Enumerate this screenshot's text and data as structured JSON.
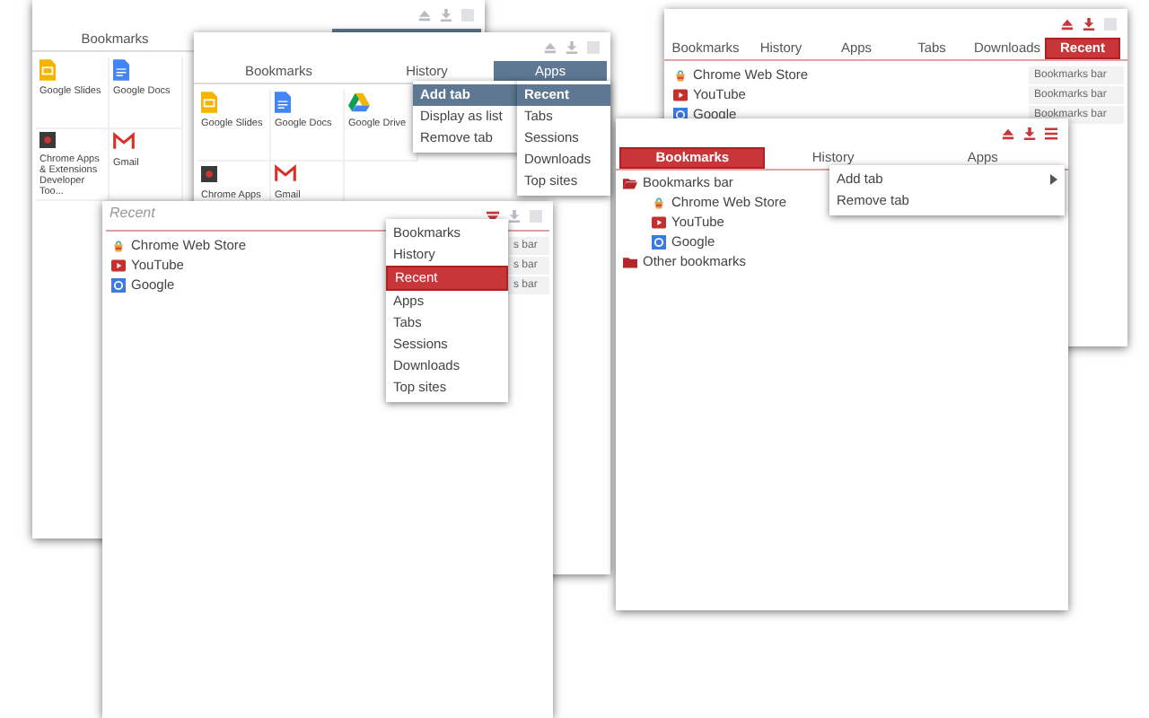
{
  "windows": [
    {
      "tabs": [
        {
          "label": "Bookmarks",
          "selected": false
        },
        {
          "selected": true
        }
      ],
      "tiles": [
        {
          "kind": "slides",
          "label": "Google Slides"
        },
        {
          "kind": "docs",
          "label": "Google Docs"
        },
        {
          "kind": "chrome-apps",
          "label": "Chrome Apps & Extensions Developer Too..."
        },
        {
          "kind": "gmail",
          "label": "Gmail"
        }
      ]
    },
    {
      "tabs": [
        {
          "label": "Bookmarks",
          "selected": false
        },
        {
          "label": "History",
          "selected": false
        },
        {
          "label": "Apps",
          "selected": true
        }
      ],
      "tiles": [
        {
          "kind": "slides",
          "label": "Google Slides"
        },
        {
          "kind": "docs",
          "label": "Google Docs"
        },
        {
          "kind": "drive",
          "label": "Google Drive"
        },
        {
          "kind": "chrome-apps",
          "label": "Chrome Apps"
        },
        {
          "kind": "gmail",
          "label": "Gmail"
        }
      ],
      "menus": [
        {
          "items": [
            {
              "label": "Add tab",
              "selected": true
            },
            {
              "label": "Display as list",
              "selected": false
            },
            {
              "label": "Remove tab",
              "selected": false
            }
          ]
        },
        {
          "items": [
            {
              "label": "Recent",
              "selected": true
            },
            {
              "label": "Tabs",
              "selected": false
            },
            {
              "label": "Sessions",
              "selected": false
            },
            {
              "label": "Downloads",
              "selected": false
            },
            {
              "label": "Top sites",
              "selected": false
            }
          ]
        }
      ]
    },
    {
      "search": {
        "placeholder": "Recent"
      },
      "rows": [
        {
          "kind": "store",
          "label": "Chrome Web Store",
          "folder": "s bar"
        },
        {
          "kind": "youtube",
          "label": "YouTube",
          "folder": "s bar"
        },
        {
          "kind": "google",
          "label": "Google",
          "folder": "s bar"
        }
      ],
      "menus": [
        {
          "items": [
            {
              "label": "Bookmarks",
              "selected": false
            },
            {
              "label": "History",
              "selected": false
            },
            {
              "label": "Recent",
              "selected": true
            },
            {
              "label": "Apps",
              "selected": false
            },
            {
              "label": "Tabs",
              "selected": false
            },
            {
              "label": "Sessions",
              "selected": false
            },
            {
              "label": "Downloads",
              "selected": false
            },
            {
              "label": "Top sites",
              "selected": false
            }
          ]
        }
      ]
    },
    {
      "tabs": [
        {
          "label": "Bookmarks",
          "selected": false
        },
        {
          "label": "History",
          "selected": false
        },
        {
          "label": "Apps",
          "selected": false
        },
        {
          "label": "Tabs",
          "selected": false
        },
        {
          "label": "Downloads",
          "selected": false
        },
        {
          "label": "Recent",
          "selected": true
        }
      ],
      "rows": [
        {
          "kind": "store",
          "label": "Chrome Web Store",
          "folder": "Bookmarks bar"
        },
        {
          "kind": "youtube",
          "label": "YouTube",
          "folder": "Bookmarks bar"
        },
        {
          "kind": "google",
          "label": "Google",
          "folder": "Bookmarks bar"
        }
      ]
    },
    {
      "tabs": [
        {
          "label": "Bookmarks",
          "selected": true
        },
        {
          "label": "History",
          "selected": false
        },
        {
          "label": "Apps",
          "selected": false
        }
      ],
      "tree": [
        {
          "kind": "folder",
          "label": "Bookmarks bar",
          "expanded": true,
          "children": [
            {
              "kind": "store",
              "label": "Chrome Web Store"
            },
            {
              "kind": "youtube",
              "label": "YouTube"
            },
            {
              "kind": "google",
              "label": "Google"
            }
          ]
        },
        {
          "kind": "folder",
          "label": "Other bookmarks",
          "expanded": false
        }
      ],
      "menus": [
        {
          "items": [
            {
              "label": "Add tab",
              "selected": false,
              "submenu": true
            },
            {
              "label": "Remove tab",
              "selected": false,
              "submenu": false
            }
          ]
        }
      ]
    }
  ]
}
